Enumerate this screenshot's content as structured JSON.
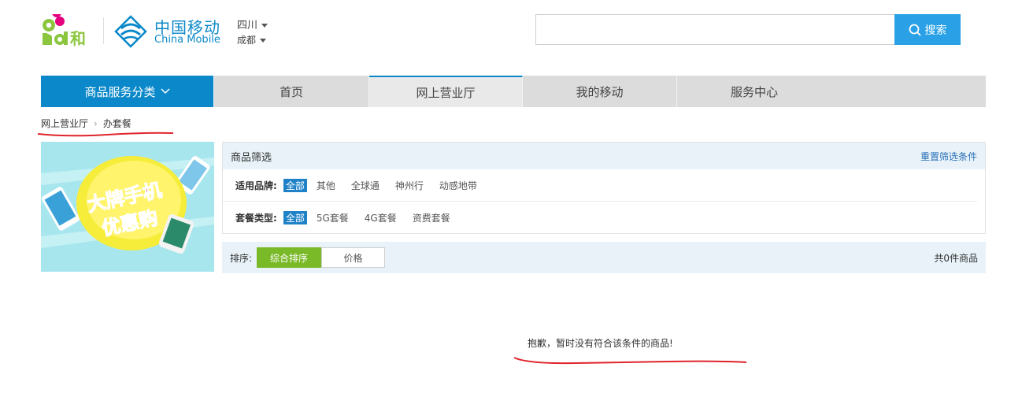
{
  "header": {
    "logo_and_text": "and",
    "logo_he_text": "和",
    "brand_cn": "中国移动",
    "brand_en": "China Mobile",
    "province": "四川",
    "city": "成都",
    "search": {
      "placeholder": "",
      "button_label": "搜索"
    }
  },
  "nav": {
    "category": "商品服务分类",
    "items": [
      "首页",
      "网上营业厅",
      "我的移动",
      "服务中心"
    ]
  },
  "breadcrumb": {
    "root": "网上营业厅",
    "separator": "›",
    "current": "办套餐"
  },
  "banner": {
    "line1": "大牌手机",
    "line2": "优惠购"
  },
  "filter": {
    "title": "商品筛选",
    "reset": "重置筛选条件",
    "brand": {
      "label": "适用品牌:",
      "options": [
        "全部",
        "其他",
        "全球通",
        "神州行",
        "动感地带"
      ]
    },
    "type": {
      "label": "套餐类型:",
      "options": [
        "全部",
        "5G套餐",
        "4G套餐",
        "资费套餐"
      ]
    }
  },
  "sort": {
    "label": "排序:",
    "default": "综合排序",
    "price": "价格",
    "count": "共0件商品"
  },
  "empty_message": "抱歉，暂时没有符合该条件的商品!",
  "colors": {
    "brand_blue": "#0a88c9",
    "search_blue": "#2aa1e6",
    "green": "#7ab928",
    "annotation_red": "#e0242c"
  }
}
